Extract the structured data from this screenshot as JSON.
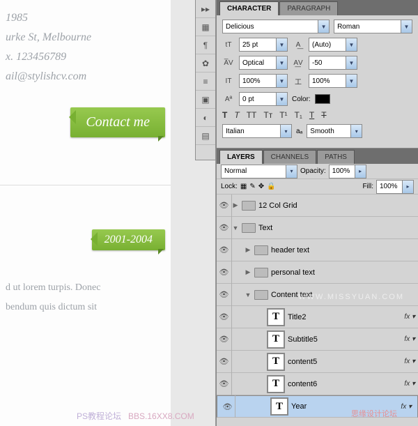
{
  "cv": {
    "year": "1985",
    "address": "urke St, Melbourne",
    "phone": "x. 123456789",
    "email": "ail@stylishcv.com",
    "contact_btn": "Contact me",
    "date_ribbon": "2001-2004",
    "body1": "d ut lorem turpis. Donec",
    "body2": "bendum quis dictum sit"
  },
  "char": {
    "tab1": "CHARACTER",
    "tab2": "PARAGRAPH",
    "font": "Delicious",
    "style": "Roman",
    "size": "25 pt",
    "leading": "(Auto)",
    "kerning": "Optical",
    "tracking": "-50",
    "vscale": "100%",
    "hscale": "100%",
    "baseline": "0 pt",
    "color_label": "Color:",
    "lang": "Italian",
    "aa_label": "aₐ",
    "aa": "Smooth"
  },
  "layers": {
    "tab1": "LAYERS",
    "tab2": "CHANNELS",
    "tab3": "PATHS",
    "blend": "Normal",
    "opacity_label": "Opacity:",
    "opacity": "100%",
    "lock_label": "Lock:",
    "fill_label": "Fill:",
    "fill": "100%",
    "items": [
      {
        "name": "12 Col Grid",
        "type": "group",
        "open": false,
        "depth": 0,
        "fx": false
      },
      {
        "name": "Text",
        "type": "group",
        "open": true,
        "depth": 0,
        "fx": false
      },
      {
        "name": "header text",
        "type": "group",
        "open": false,
        "depth": 1,
        "fx": false
      },
      {
        "name": "personal text",
        "type": "group",
        "open": false,
        "depth": 1,
        "fx": false
      },
      {
        "name": "Content text",
        "type": "group",
        "open": true,
        "depth": 1,
        "fx": false
      },
      {
        "name": "Title2",
        "type": "text",
        "depth": 2,
        "fx": true
      },
      {
        "name": "Subtitle5",
        "type": "text",
        "depth": 2,
        "fx": true
      },
      {
        "name": "content5",
        "type": "text",
        "depth": 2,
        "fx": true
      },
      {
        "name": "content6",
        "type": "text",
        "depth": 2,
        "fx": true
      },
      {
        "name": "Year",
        "type": "text",
        "depth": 2,
        "fx": true,
        "selected": true
      }
    ]
  },
  "watermarks": {
    "w1": "WWW.MISSYUAN.COM",
    "w2": "思缘设计论坛",
    "w3": "PS教程论坛",
    "w4": "BBS.16XX8.COM"
  }
}
